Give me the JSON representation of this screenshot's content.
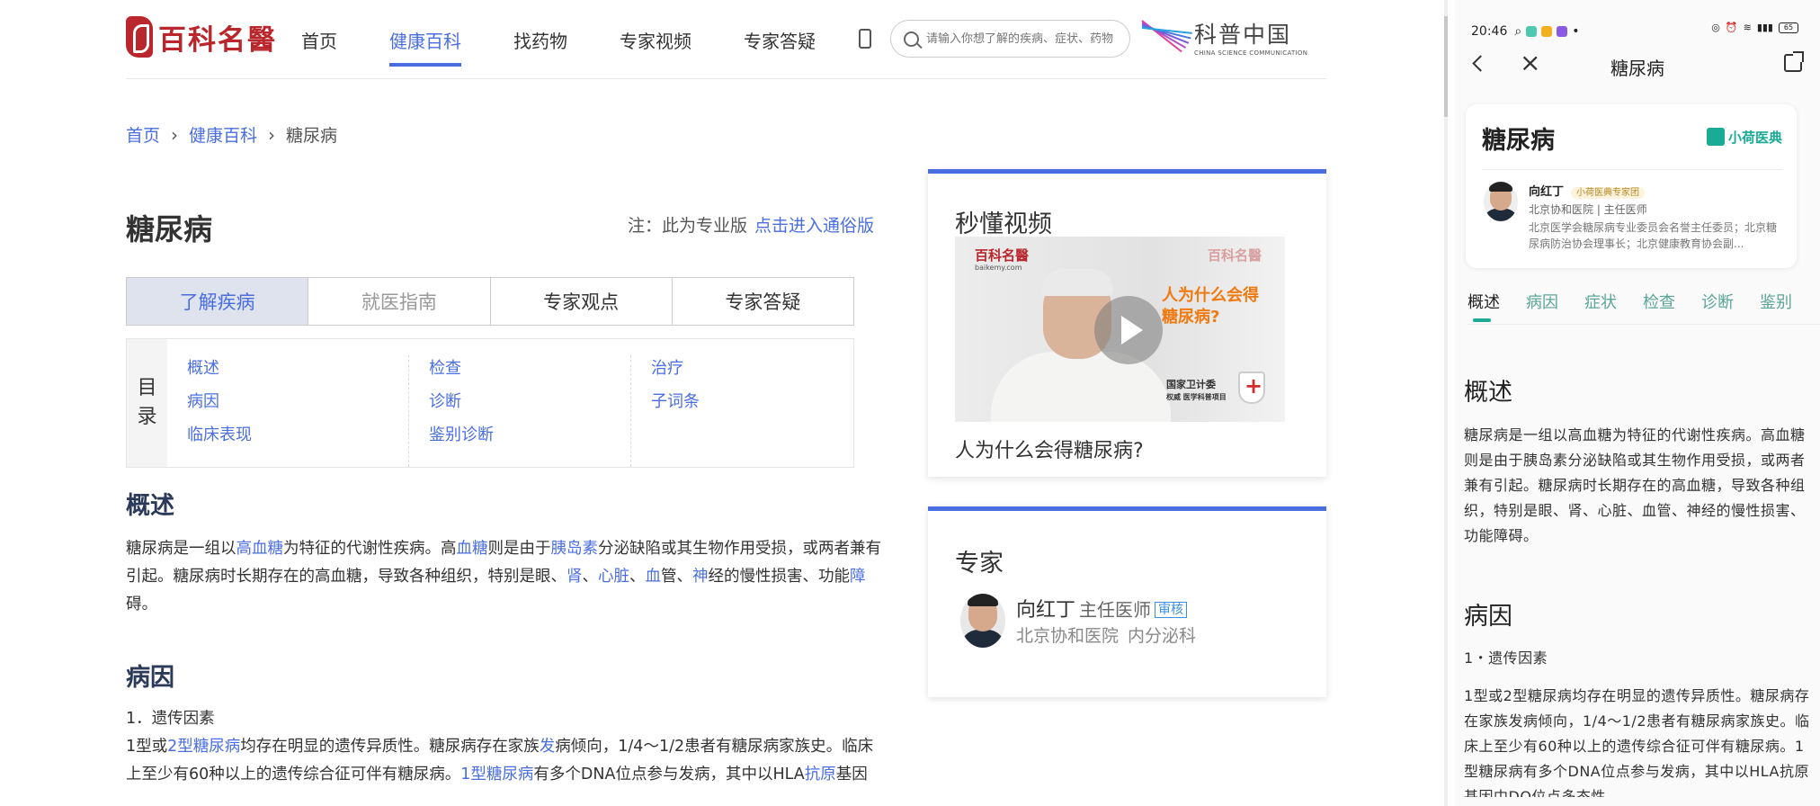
{
  "desktop": {
    "logo_text": "百科名醫",
    "nav": [
      {
        "label": "首页"
      },
      {
        "label": "健康百科"
      },
      {
        "label": "找药物"
      },
      {
        "label": "专家视频"
      },
      {
        "label": "专家答疑"
      }
    ],
    "search_placeholder": "请输入你想了解的疾病、症状、药物",
    "partner": {
      "cn": "科普中国",
      "en": "CHINA SCIENCE COMMUNICATION"
    },
    "breadcrumb": [
      "首页",
      "健康百科",
      "糖尿病"
    ],
    "title": "糖尿病",
    "note_prefix": "注：此为专业版",
    "note_link": "点击进入通俗版",
    "tabs": [
      "了解疾病",
      "就医指南",
      "专家观点",
      "专家答疑"
    ],
    "toc_label": [
      "目",
      "录"
    ],
    "toc_columns": [
      [
        "概述",
        "病因",
        "临床表现"
      ],
      [
        "检查",
        "诊断",
        "鉴别诊断"
      ],
      [
        "治疗",
        "子词条"
      ]
    ],
    "overview_heading": "概述",
    "overview_segments": [
      {
        "t": "糖尿病是一组以"
      },
      {
        "t": "高血糖",
        "link": true
      },
      {
        "t": "为特征的代谢性疾病。高"
      },
      {
        "t": "血糖",
        "link": true
      },
      {
        "t": "则是由于"
      },
      {
        "t": "胰岛素",
        "link": true
      },
      {
        "t": "分泌缺陷或其生物作用受损，或两者兼有引起。糖尿病时长期存在的高血糖，导致各种组织，特别是眼、"
      },
      {
        "t": "肾",
        "link": true
      },
      {
        "t": "、"
      },
      {
        "t": "心脏",
        "link": true
      },
      {
        "t": "、"
      },
      {
        "t": "血",
        "link": true
      },
      {
        "t": "管、"
      },
      {
        "t": "神",
        "link": true
      },
      {
        "t": "经的慢性损害、功能"
      },
      {
        "t": "障",
        "link": true
      },
      {
        "t": "碍。"
      }
    ],
    "cause_heading": "病因",
    "cause_sub": "1．遗传因素",
    "cause_segments": [
      {
        "t": "1型或"
      },
      {
        "t": "2型糖尿病",
        "link": true
      },
      {
        "t": "均存在明显的遗传异质性。糖尿病存在家族"
      },
      {
        "t": "发",
        "link": true
      },
      {
        "t": "病倾向，1/4～1/2患者有糖尿病家族史。临床上至少有60种以上的遗传综合征可伴有糖尿病。"
      },
      {
        "t": "1型糖尿病",
        "link": true
      },
      {
        "t": "有多个DNA位点参与发病，其中以HLA"
      },
      {
        "t": "抗原",
        "link": true
      },
      {
        "t": "基因"
      }
    ],
    "video_card": {
      "title": "秒懂视频",
      "thumb_logo": "百科名醫",
      "thumb_site": "baikemy.com",
      "thumb_logo_right": "百科名醫",
      "thumb_question": "人为什么会得糖尿病?",
      "thumb_badge_1": "国家卫计委",
      "thumb_badge_2": "权威 医学科普项目",
      "caption": "人为什么会得糖尿病?"
    },
    "expert_card": {
      "title": "专家",
      "name": "向红丁",
      "rank": "主任医师",
      "badge": "审核",
      "hospital": "北京协和医院",
      "dept": "内分泌科"
    }
  },
  "phone": {
    "status_time": "20:46",
    "battery": "65",
    "title": "糖尿病",
    "card": {
      "title": "糖尿病",
      "brand": "小荷医典",
      "expert_name": "向红丁",
      "expert_tag": "小荷医典专家团",
      "expert_org": "北京协和医院 | 主任医师",
      "expert_intro": "北京医学会糖尿病专业委员会名誉主任委员；北京糖尿病防治协会理事长；北京健康教育协会副..."
    },
    "tabs": [
      "概述",
      "病因",
      "症状",
      "检查",
      "诊断",
      "鉴别"
    ],
    "overview_heading": "概述",
    "overview_text": "糖尿病是一组以高血糖为特征的代谢性疾病。高血糖则是由于胰岛素分泌缺陷或其生物作用受损，或两者兼有引起。糖尿病时长期存在的高血糖，导致各种组织，特别是眼、肾、心脏、血管、神经的慢性损害、功能障碍。",
    "cause_heading": "病因",
    "cause_sub": "1・遗传因素",
    "cause_text": "1型或2型糖尿病均存在明显的遗传异质性。糖尿病存在家族发病倾向，1/4～1/2患者有糖尿病家族史。临床上至少有60种以上的遗传综合征可伴有糖尿病。1型糖尿病有多个DNA位点参与发病，其中以HLA抗原基因中DQ位点多态性"
  },
  "colors": {
    "accent": "#4a6ee0",
    "brand_red": "#b9262b",
    "phone_accent": "#1aab94"
  }
}
